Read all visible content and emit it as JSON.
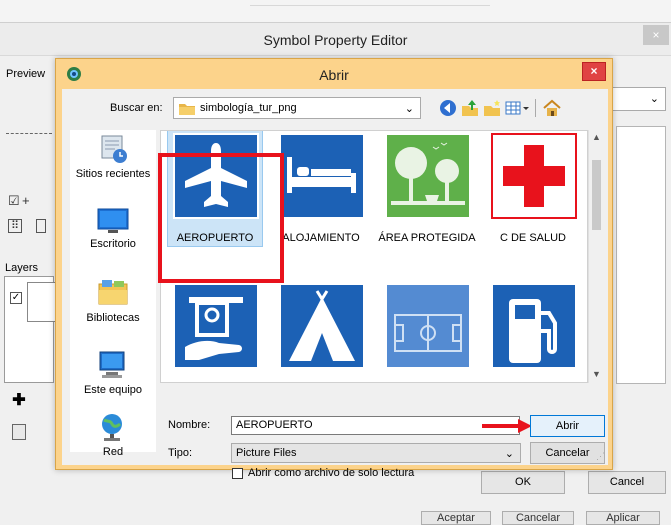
{
  "background_window": {
    "title": "Symbol Property Editor",
    "close_label": "×",
    "preview_label": "Preview",
    "layers_label": "Layers",
    "ok_label": "OK",
    "cancel_label": "Cancel",
    "bottom_buttons": [
      "Aceptar",
      "Cancelar",
      "Aplicar"
    ]
  },
  "dialog": {
    "title": "Abrir",
    "close_label": "×",
    "look_in_label": "Buscar en:",
    "look_in_value": "simbología_tur_png",
    "places": [
      {
        "label": "Sitios recientes",
        "icon": "recent-places-icon"
      },
      {
        "label": "Escritorio",
        "icon": "desktop-icon"
      },
      {
        "label": "Bibliotecas",
        "icon": "libraries-icon"
      },
      {
        "label": "Este equipo",
        "icon": "this-pc-icon"
      },
      {
        "label": "Red",
        "icon": "network-icon"
      }
    ],
    "files": [
      {
        "label": "AEROPUERTO",
        "icon": "airplane-icon",
        "selected": true
      },
      {
        "label": "ALOJAMIENTO",
        "icon": "bed-icon",
        "selected": false
      },
      {
        "label": "ÁREA PROTEGIDA",
        "icon": "protected-area-icon",
        "selected": false
      },
      {
        "label": "C DE SALUD",
        "icon": "red-cross-icon",
        "selected": false
      },
      {
        "label": "",
        "icon": "atm-icon",
        "selected": false
      },
      {
        "label": "",
        "icon": "camping-tent-icon",
        "selected": false
      },
      {
        "label": "",
        "icon": "soccer-field-icon",
        "selected": false
      },
      {
        "label": "",
        "icon": "fuel-pump-icon",
        "selected": false
      }
    ],
    "file_name_label": "Nombre:",
    "file_name_value": "AEROPUERTO",
    "file_type_label": "Tipo:",
    "file_type_value": "Picture Files",
    "open_label": "Abrir",
    "cancel_label": "Cancelar",
    "read_only_label": "Abrir como archivo de solo lectura",
    "colors": {
      "dialog_frame": "#fcd38b",
      "sign_blue": "#1c61b5",
      "sign_green": "#5fb04a",
      "highlight_red": "#e8121c"
    }
  }
}
